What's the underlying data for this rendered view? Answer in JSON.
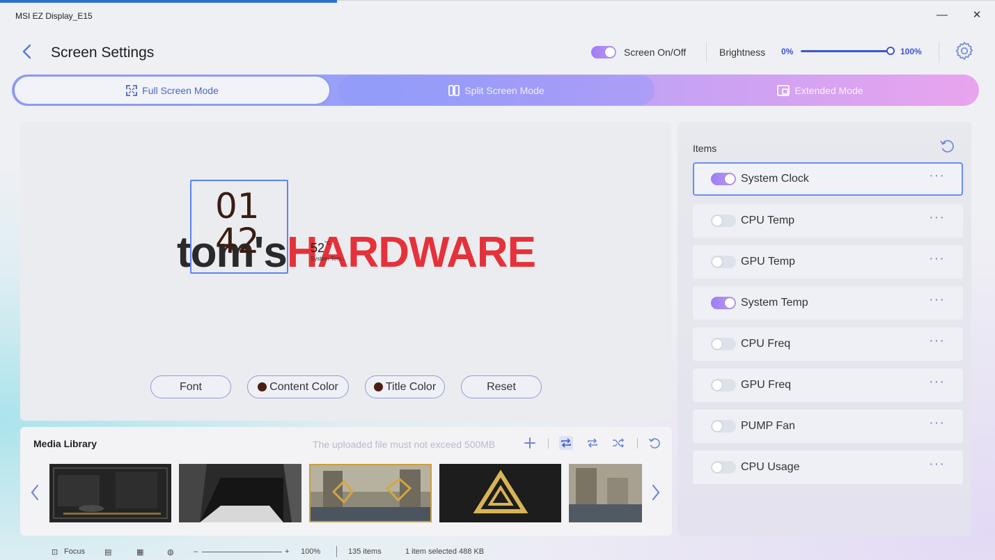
{
  "window": {
    "title": "MSI EZ Display_E15"
  },
  "header": {
    "title": "Screen Settings",
    "screen_label": "Screen On/Off",
    "screen_on": true,
    "brightness_label": "Brightness",
    "brightness_min": "0%",
    "brightness_max": "100%",
    "brightness_value": 1.0
  },
  "modes": [
    {
      "label": "Full Screen Mode",
      "active": true
    },
    {
      "label": "Split Screen Mode",
      "active": false
    },
    {
      "label": "Extended Mode",
      "active": false
    }
  ],
  "preview": {
    "logo_part1": "tom's",
    "logo_part2": "HARDWARE",
    "clock_hour": "01",
    "clock_minute": "42",
    "temp_value": "52",
    "temp_unit": "°C",
    "temp_title": "System Tem..."
  },
  "controls": {
    "font": "Font",
    "content_color": "Content Color",
    "title_color": "Title Color",
    "reset": "Reset",
    "content_color_hex": "#4a1f12",
    "title_color_hex": "#4a1f12"
  },
  "media": {
    "title": "Media Library",
    "note": "The uploaded file must not exceed 500MB"
  },
  "items": {
    "title": "Items",
    "list": [
      {
        "label": "System Clock",
        "on": true,
        "selected": true
      },
      {
        "label": "CPU Temp",
        "on": false,
        "selected": false
      },
      {
        "label": "GPU Temp",
        "on": false,
        "selected": false
      },
      {
        "label": "System Temp",
        "on": true,
        "selected": false
      },
      {
        "label": "CPU Freq",
        "on": false,
        "selected": false
      },
      {
        "label": "GPU Freq",
        "on": false,
        "selected": false
      },
      {
        "label": "PUMP Fan",
        "on": false,
        "selected": false
      },
      {
        "label": "CPU Usage",
        "on": false,
        "selected": false
      }
    ]
  },
  "statusbar": {
    "focus": "Focus",
    "zoom": "100%",
    "items_count": "135 items",
    "selection": "1 item selected  488 KB"
  },
  "colors": {
    "accent": "#3b55d9",
    "logo_red": "#e5323a",
    "selection": "#6a8cf0"
  }
}
